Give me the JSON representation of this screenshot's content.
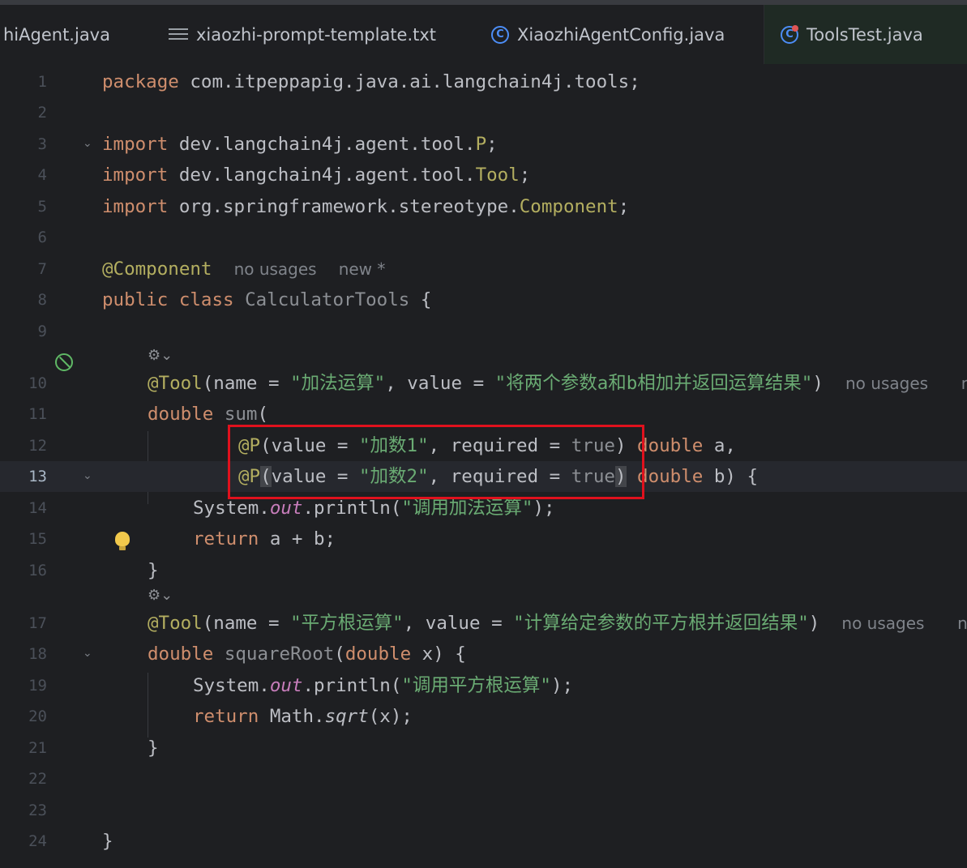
{
  "tabs": [
    {
      "label": "hiAgent.java",
      "icon": "class-icon"
    },
    {
      "label": "xiaozhi-prompt-template.txt",
      "icon": "text-file-icon"
    },
    {
      "label": "XiaozhiAgentConfig.java",
      "icon": "class-icon"
    },
    {
      "label": "ToolsTest.java",
      "icon": "test-class-icon",
      "active": true
    }
  ],
  "line_numbers": [
    "1",
    "2",
    "3",
    "4",
    "5",
    "6",
    "7",
    "8",
    "9",
    "10",
    "11",
    "12",
    "13",
    "14",
    "15",
    "16",
    "17",
    "18",
    "19",
    "20",
    "21",
    "22",
    "23",
    "24"
  ],
  "current_line": "13",
  "code": {
    "l1_kw": "package",
    "l1_rest": " com.itpeppapig.java.ai.langchain4j.tools;",
    "l3_kw": "import",
    "l3_pkg": " dev.langchain4j.agent.tool.",
    "l3_cls": "P",
    "l4_kw": "import",
    "l4_pkg": " dev.langchain4j.agent.tool.",
    "l4_cls": "Tool",
    "l5_kw": "import",
    "l5_pkg": " org.springframework.stereotype.",
    "l5_cls": "Component",
    "semi": ";",
    "l7_ann": "@Component",
    "l7_hint1": "no usages",
    "l7_hint2": "new *",
    "l8_kw": "public class",
    "l8_name": " CalculatorTools",
    "l8_brace": " {",
    "l10_ann": "@Tool",
    "l10_a": "(name = ",
    "l10_name": "\"加法运算\"",
    "l10_b": ", value = ",
    "l10_value": "\"将两个参数a和b相加并返回运算结果\"",
    "l10_c": ")",
    "l10_hint1": "no usages",
    "l10_hint2": "new",
    "l11_kw": "double",
    "l11_fn": " sum",
    "l11_paren": "(",
    "l12_ann": "@P",
    "l12_a": "(value = ",
    "l12_str": "\"加数1\"",
    "l12_b": ", required = ",
    "l12_true": "true",
    "l12_c": ")",
    "l12_kw": " double",
    "l12_var": " a,",
    "l13_ann": "@P",
    "l13_paren_open": "(",
    "l13_a": "value = ",
    "l13_str": "\"加数2\"",
    "l13_b": ", required = ",
    "l13_true": "true",
    "l13_paren_close": ")",
    "l13_kw": " double",
    "l13_var": " b) {",
    "l14_sys": "System.",
    "l14_out": "out",
    "l14_println": ".println(",
    "l14_str": "\"调用加法运算\"",
    "l14_end": ");",
    "l15_kw": "return",
    "l15_rest": " a + b;",
    "l16": "}",
    "l17_ann": "@Tool",
    "l17_a": "(name = ",
    "l17_name": "\"平方根运算\"",
    "l17_b": ", value = ",
    "l17_value": "\"计算给定参数的平方根并返回结果\"",
    "l17_c": ")",
    "l17_hint1": "no usages",
    "l17_hint2": "new",
    "l18_kw": "double",
    "l18_fn": " squareRoot",
    "l18_paren": "(",
    "l18_kw2": "double",
    "l18_rest": " x) {",
    "l19_sys": "System.",
    "l19_out": "out",
    "l19_println": ".println(",
    "l19_str": "\"调用平方根运算\"",
    "l19_end": ");",
    "l20_kw": "return",
    "l20_math": " Math.",
    "l20_sqrt": "sqrt",
    "l20_end": "(x);",
    "l21": "}",
    "l24": "}"
  },
  "colors": {
    "background": "#1e1f22",
    "keyword": "#cf8e6d",
    "string": "#6aab73",
    "annotation": "#b3ae60",
    "highlight_box": "#e0111d"
  }
}
